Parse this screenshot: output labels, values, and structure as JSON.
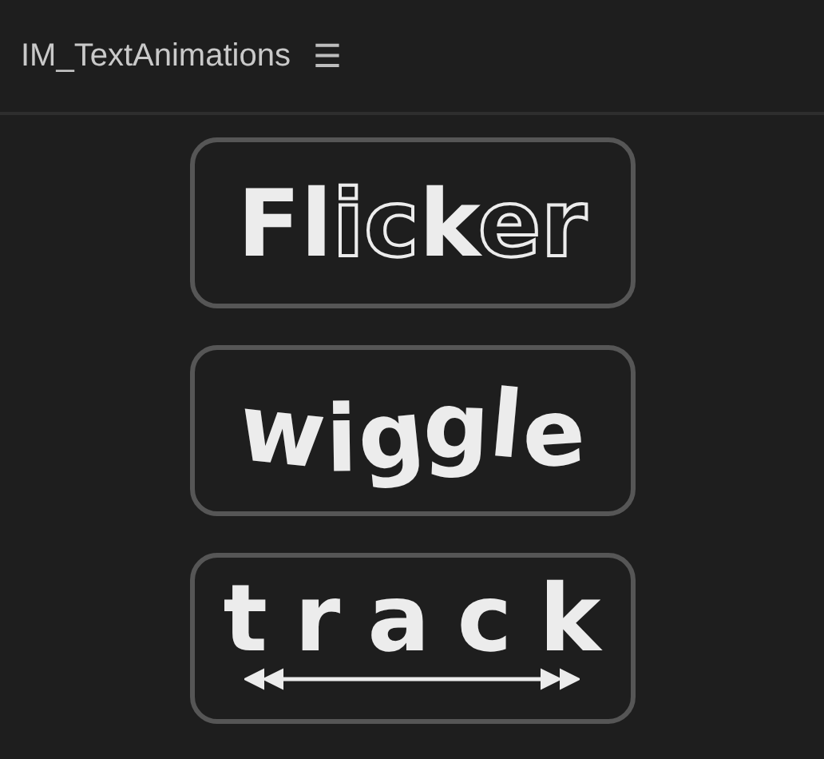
{
  "panel": {
    "title": "IM_TextAnimations",
    "menu_icon": "☰"
  },
  "buttons": [
    {
      "label": "Flicker",
      "kind": "flicker"
    },
    {
      "label": "wiggle",
      "kind": "wiggle"
    },
    {
      "label": "track",
      "kind": "track"
    }
  ]
}
